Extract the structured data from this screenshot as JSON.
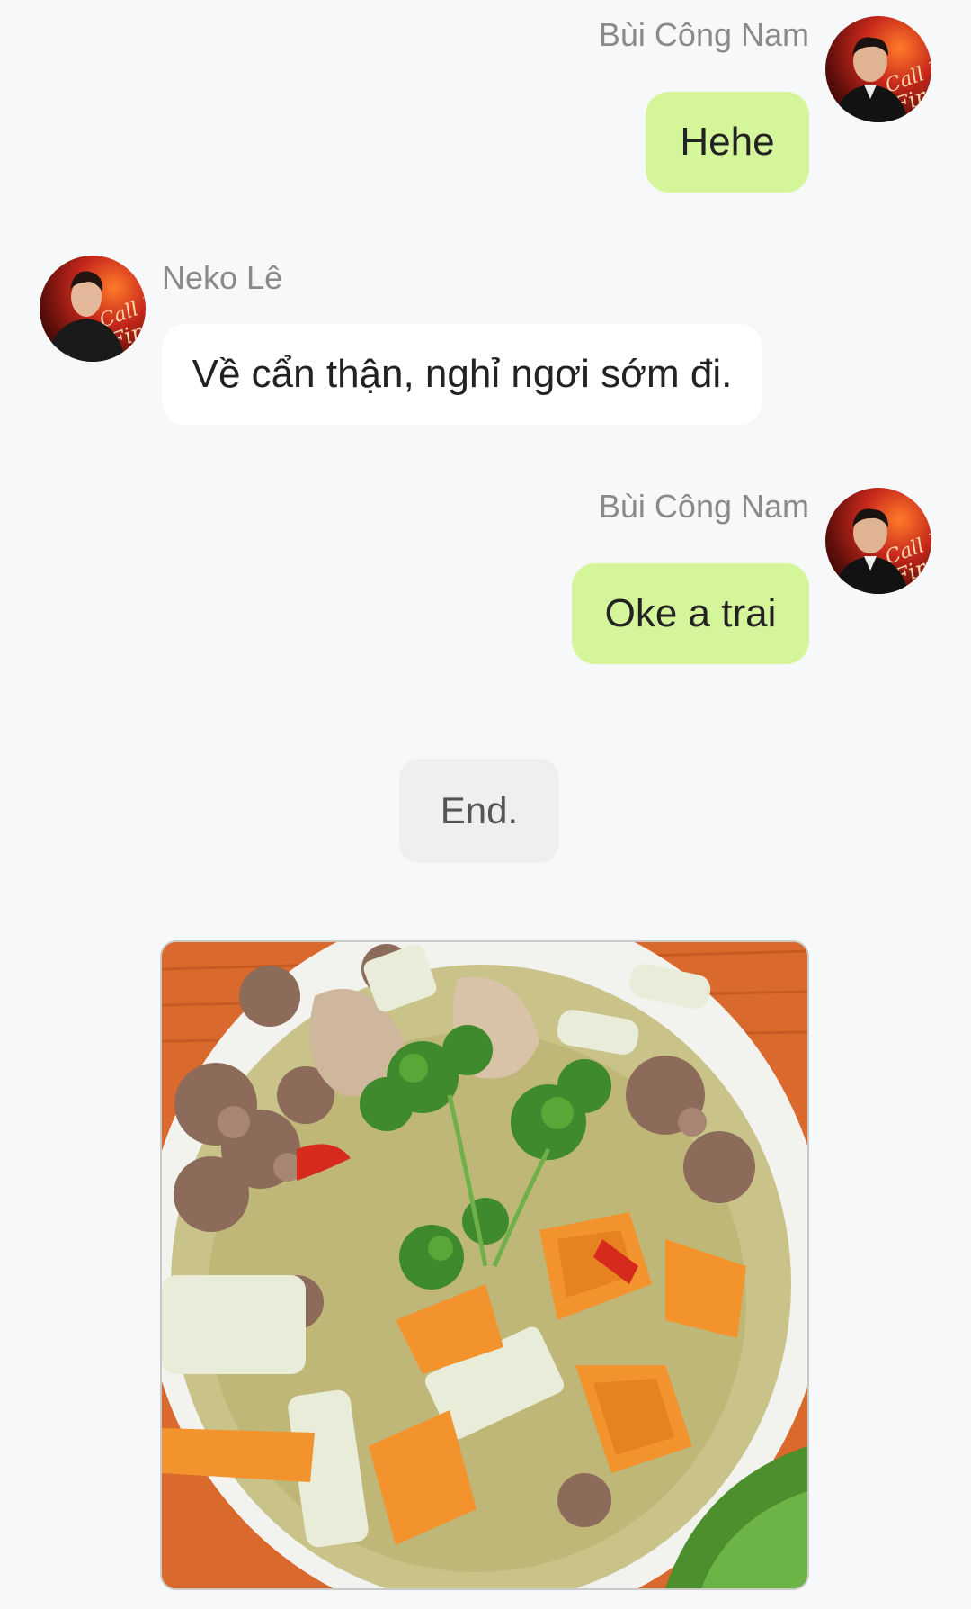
{
  "messages": [
    {
      "sender": "Bùi Công Nam",
      "text": "Hehe",
      "side": "right"
    },
    {
      "sender": "Neko Lê",
      "text": "Về cẩn thận, nghỉ ngơi sớm đi.",
      "side": "left"
    },
    {
      "sender": "Bùi Công Nam",
      "text": "Oke a trai",
      "side": "right"
    }
  ],
  "end_label": "End.",
  "avatar_poster_text": "Call Me By Fire",
  "colors": {
    "background": "#f6f8fa",
    "my_bubble": "#d5f59a",
    "other_bubble": "#ffffff",
    "end_pill": "#efefef",
    "name_text": "#8a8a8a"
  },
  "image": {
    "icon": "food-photo-soup-bowl"
  }
}
